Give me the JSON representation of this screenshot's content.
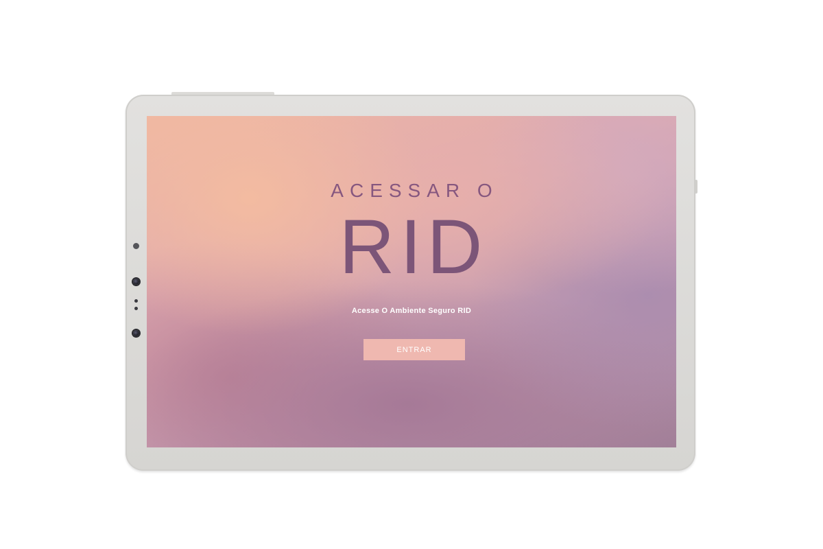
{
  "screen": {
    "headline": "ACESSAR O",
    "title": "RID",
    "subtitle": "Acesse O Ambiente Seguro RID",
    "enter_button_label": "ENTRAR"
  },
  "colors": {
    "title": "#7c5578",
    "button": "#efb8b0",
    "button_text": "#ffffff",
    "bezel": "#dcdbd8"
  },
  "icons": {
    "camera": "camera-icon",
    "sensor": "sensor-icon"
  }
}
